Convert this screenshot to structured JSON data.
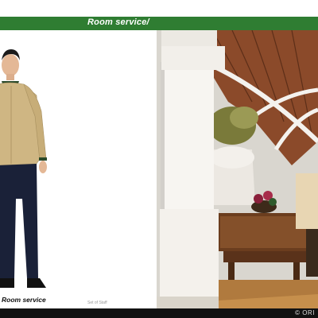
{
  "header": {
    "title": "Room service/"
  },
  "figure": {
    "caption": "Room service",
    "subcaption": "Set of Staff"
  },
  "footer": {
    "copyright": "© ORI"
  },
  "colors": {
    "header_green": "#2f7d32",
    "jacket_tan": "#cfb683",
    "trousers_navy": "#1a2138",
    "footer_black": "#111111"
  },
  "photo": {
    "alt": "Hotel lobby with white pillar and wooden table"
  }
}
